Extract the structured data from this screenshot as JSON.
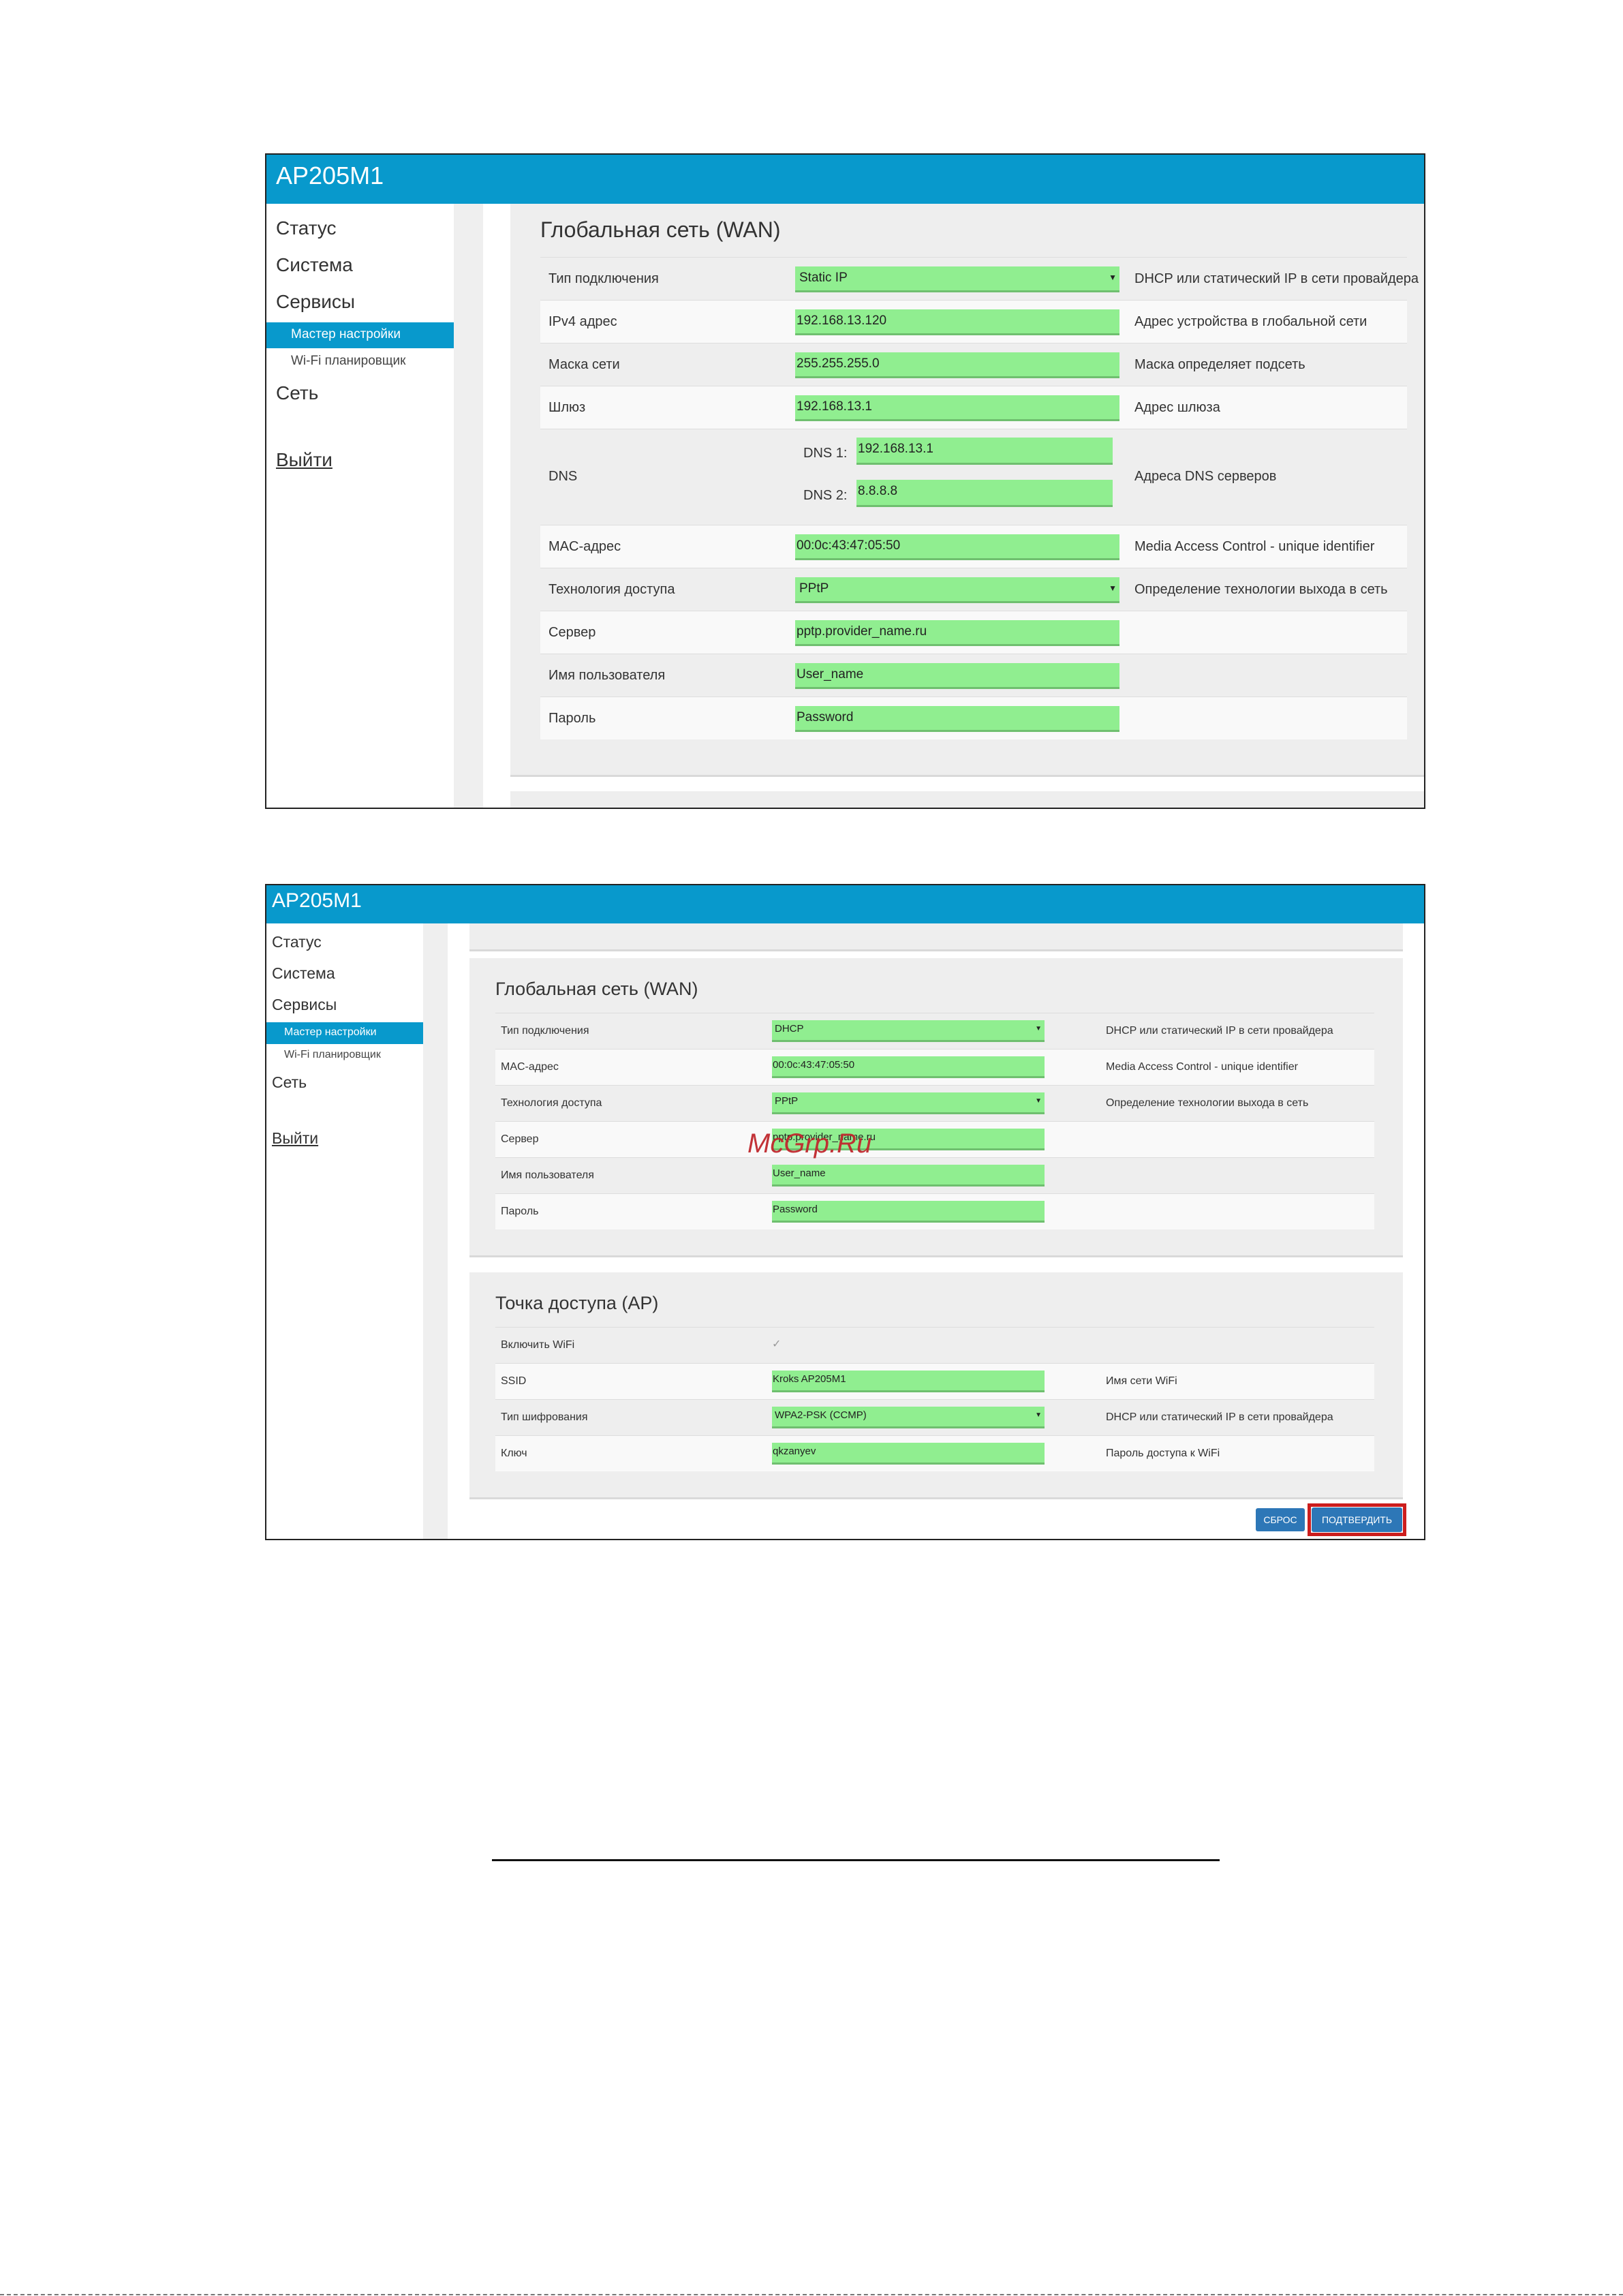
{
  "app_title": "AP205M1",
  "nav": {
    "status": "Статус",
    "system": "Система",
    "services": "Сервисы",
    "wizard": "Мастер настройки",
    "wifi_scheduler": "Wi-Fi планировщик",
    "network": "Сеть",
    "logout": "Выйти"
  },
  "shot1": {
    "section_title": "Глобальная сеть (WAN)",
    "rows": {
      "conn_type": {
        "label": "Тип подключения",
        "value": "Static IP",
        "desc": "DHCP или статический IP в сети провайдера"
      },
      "ipv4": {
        "label": "IPv4 адрес",
        "value": "192.168.13.120",
        "desc": "Адрес устройства в глобальной сети"
      },
      "mask": {
        "label": "Маска сети",
        "value": "255.255.255.0",
        "desc": "Маска определяет подсеть"
      },
      "gateway": {
        "label": "Шлюз",
        "value": "192.168.13.1",
        "desc": "Адрес шлюза"
      },
      "dns": {
        "label": "DNS",
        "dns1_label": "DNS 1:",
        "dns1": "192.168.13.1",
        "dns2_label": "DNS 2:",
        "dns2": "8.8.8.8",
        "desc": "Адреса DNS серверов"
      },
      "mac": {
        "label": "MAC-адрес",
        "value": "00:0c:43:47:05:50",
        "desc": "Media Access Control - unique identifier"
      },
      "access_tech": {
        "label": "Технология доступа",
        "value": "PPtP",
        "desc": "Определение технологии выхода в сеть"
      },
      "server": {
        "label": "Сервер",
        "value": "pptp.provider_name.ru"
      },
      "username": {
        "label": "Имя пользователя",
        "value": "User_name"
      },
      "password": {
        "label": "Пароль",
        "value": "Password"
      }
    }
  },
  "shot2": {
    "wan_title": "Глобальная сеть (WAN)",
    "wan_rows": {
      "conn_type": {
        "label": "Тип подключения",
        "value": "DHCP",
        "desc": "DHCP или статический IP в сети провайдера"
      },
      "mac": {
        "label": "MAC-адрес",
        "value": "00:0c:43:47:05:50",
        "desc": "Media Access Control - unique identifier"
      },
      "access_tech": {
        "label": "Технология доступа",
        "value": "PPtP",
        "desc": "Определение технологии выхода в сеть"
      },
      "server": {
        "label": "Сервер",
        "value": "pptp.provider_name.ru"
      },
      "username": {
        "label": "Имя пользователя",
        "value": "User_name"
      },
      "password": {
        "label": "Пароль",
        "value": "Password"
      }
    },
    "ap_title": "Точка доступа (AP)",
    "ap_rows": {
      "enable_wifi": {
        "label": "Включить WiFi",
        "checked": "✓"
      },
      "ssid": {
        "label": "SSID",
        "value": "Kroks AP205M1",
        "desc": "Имя сети WiFi"
      },
      "encryption": {
        "label": "Тип шифрования",
        "value": "WPA2-PSK (CCMP)",
        "desc": "DHCP или статический IP в сети провайдера"
      },
      "key": {
        "label": "Ключ",
        "value": "qkzanyev",
        "desc": "Пароль доступа к WiFi"
      }
    },
    "reset_button": "СБРОС",
    "confirm_button": "ПОДТВЕРДИТЬ"
  },
  "watermark": "McGrp.Ru",
  "select_arrow": "▼",
  "colors": {
    "header_blue": "#0899cc",
    "field_green": "#90ee90",
    "button_blue": "#2d77b7",
    "highlight_red": "#cc1d1d",
    "watermark_red": "#c0282d"
  }
}
